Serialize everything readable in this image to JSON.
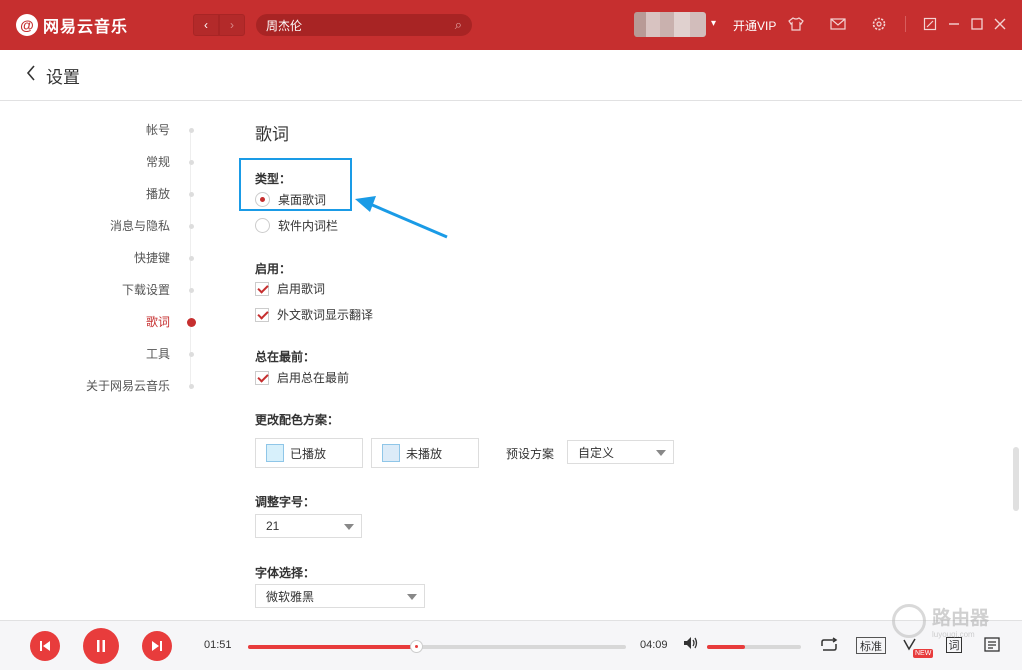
{
  "app": {
    "logo_glyph": "@",
    "title": "网易云音乐"
  },
  "nav": {
    "back": "‹",
    "forward": "›"
  },
  "search": {
    "value": "周杰伦"
  },
  "user": {
    "caret": "▾",
    "vip_label": "开通VIP"
  },
  "page": {
    "title": "设置"
  },
  "sidebar": {
    "items": [
      {
        "label": "帐号"
      },
      {
        "label": "常规"
      },
      {
        "label": "播放"
      },
      {
        "label": "消息与隐私"
      },
      {
        "label": "快捷键"
      },
      {
        "label": "下载设置"
      },
      {
        "label": "歌词",
        "active": true
      },
      {
        "label": "工具"
      },
      {
        "label": "关于网易云音乐"
      }
    ]
  },
  "lyrics": {
    "section_title": "歌词",
    "type_label": "类型：",
    "type_options": [
      {
        "label": "桌面歌词",
        "selected": true
      },
      {
        "label": "软件内词栏",
        "selected": false
      }
    ],
    "enable_label": "启用：",
    "enable_options": [
      {
        "label": "启用歌词",
        "checked": true
      },
      {
        "label": "外文歌词显示翻译",
        "checked": true
      }
    ],
    "ontop_label": "总在最前：",
    "ontop_options": [
      {
        "label": "启用总在最前",
        "checked": true
      }
    ],
    "color_label": "更改配色方案：",
    "played_label": "已播放",
    "unplayed_label": "未播放",
    "played_color": "#d7f0fb",
    "unplayed_color": "#dcebf8",
    "preset_label": "预设方案",
    "preset_value": "自定义",
    "fontsize_label": "调整字号：",
    "fontsize_value": "21",
    "font_label": "字体选择：",
    "font_value": "微软雅黑"
  },
  "player": {
    "current_time": "01:51",
    "total_time": "04:09",
    "progress": 0.445,
    "volume": 0.4,
    "quality": "标准",
    "new_badge": "NEW",
    "lyric_btn": "词"
  },
  "watermark": {
    "text": "路由器",
    "sub": "luyouqi.com"
  },
  "colors": {
    "brand": "#c62f2f",
    "accent": "#e83c3c",
    "highlight": "#1a9be6"
  }
}
